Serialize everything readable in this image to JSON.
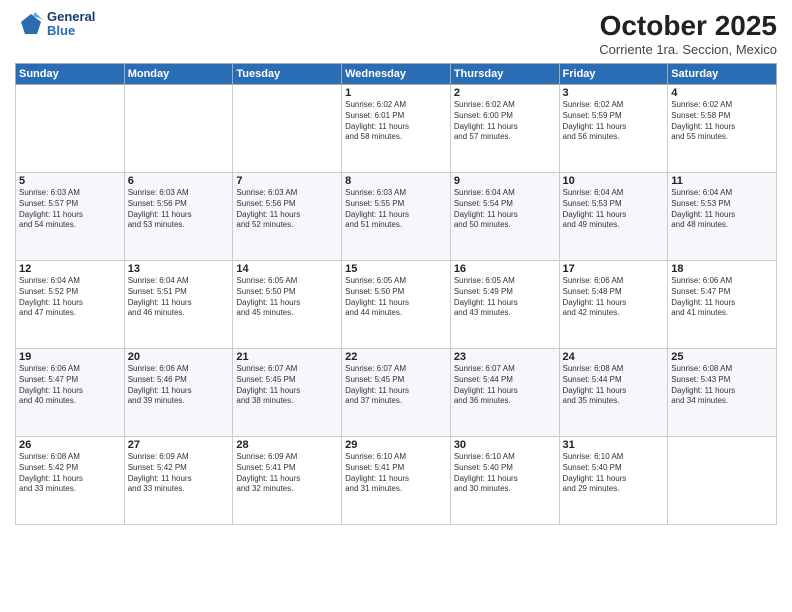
{
  "header": {
    "logo_line1": "General",
    "logo_line2": "Blue",
    "month_title": "October 2025",
    "subtitle": "Corriente 1ra. Seccion, Mexico"
  },
  "weekdays": [
    "Sunday",
    "Monday",
    "Tuesday",
    "Wednesday",
    "Thursday",
    "Friday",
    "Saturday"
  ],
  "weeks": [
    [
      {
        "day": "",
        "info": ""
      },
      {
        "day": "",
        "info": ""
      },
      {
        "day": "",
        "info": ""
      },
      {
        "day": "1",
        "info": "Sunrise: 6:02 AM\nSunset: 6:01 PM\nDaylight: 11 hours\nand 58 minutes."
      },
      {
        "day": "2",
        "info": "Sunrise: 6:02 AM\nSunset: 6:00 PM\nDaylight: 11 hours\nand 57 minutes."
      },
      {
        "day": "3",
        "info": "Sunrise: 6:02 AM\nSunset: 5:59 PM\nDaylight: 11 hours\nand 56 minutes."
      },
      {
        "day": "4",
        "info": "Sunrise: 6:02 AM\nSunset: 5:58 PM\nDaylight: 11 hours\nand 55 minutes."
      }
    ],
    [
      {
        "day": "5",
        "info": "Sunrise: 6:03 AM\nSunset: 5:57 PM\nDaylight: 11 hours\nand 54 minutes."
      },
      {
        "day": "6",
        "info": "Sunrise: 6:03 AM\nSunset: 5:56 PM\nDaylight: 11 hours\nand 53 minutes."
      },
      {
        "day": "7",
        "info": "Sunrise: 6:03 AM\nSunset: 5:56 PM\nDaylight: 11 hours\nand 52 minutes."
      },
      {
        "day": "8",
        "info": "Sunrise: 6:03 AM\nSunset: 5:55 PM\nDaylight: 11 hours\nand 51 minutes."
      },
      {
        "day": "9",
        "info": "Sunrise: 6:04 AM\nSunset: 5:54 PM\nDaylight: 11 hours\nand 50 minutes."
      },
      {
        "day": "10",
        "info": "Sunrise: 6:04 AM\nSunset: 5:53 PM\nDaylight: 11 hours\nand 49 minutes."
      },
      {
        "day": "11",
        "info": "Sunrise: 6:04 AM\nSunset: 5:53 PM\nDaylight: 11 hours\nand 48 minutes."
      }
    ],
    [
      {
        "day": "12",
        "info": "Sunrise: 6:04 AM\nSunset: 5:52 PM\nDaylight: 11 hours\nand 47 minutes."
      },
      {
        "day": "13",
        "info": "Sunrise: 6:04 AM\nSunset: 5:51 PM\nDaylight: 11 hours\nand 46 minutes."
      },
      {
        "day": "14",
        "info": "Sunrise: 6:05 AM\nSunset: 5:50 PM\nDaylight: 11 hours\nand 45 minutes."
      },
      {
        "day": "15",
        "info": "Sunrise: 6:05 AM\nSunset: 5:50 PM\nDaylight: 11 hours\nand 44 minutes."
      },
      {
        "day": "16",
        "info": "Sunrise: 6:05 AM\nSunset: 5:49 PM\nDaylight: 11 hours\nand 43 minutes."
      },
      {
        "day": "17",
        "info": "Sunrise: 6:06 AM\nSunset: 5:48 PM\nDaylight: 11 hours\nand 42 minutes."
      },
      {
        "day": "18",
        "info": "Sunrise: 6:06 AM\nSunset: 5:47 PM\nDaylight: 11 hours\nand 41 minutes."
      }
    ],
    [
      {
        "day": "19",
        "info": "Sunrise: 6:06 AM\nSunset: 5:47 PM\nDaylight: 11 hours\nand 40 minutes."
      },
      {
        "day": "20",
        "info": "Sunrise: 6:06 AM\nSunset: 5:46 PM\nDaylight: 11 hours\nand 39 minutes."
      },
      {
        "day": "21",
        "info": "Sunrise: 6:07 AM\nSunset: 5:45 PM\nDaylight: 11 hours\nand 38 minutes."
      },
      {
        "day": "22",
        "info": "Sunrise: 6:07 AM\nSunset: 5:45 PM\nDaylight: 11 hours\nand 37 minutes."
      },
      {
        "day": "23",
        "info": "Sunrise: 6:07 AM\nSunset: 5:44 PM\nDaylight: 11 hours\nand 36 minutes."
      },
      {
        "day": "24",
        "info": "Sunrise: 6:08 AM\nSunset: 5:44 PM\nDaylight: 11 hours\nand 35 minutes."
      },
      {
        "day": "25",
        "info": "Sunrise: 6:08 AM\nSunset: 5:43 PM\nDaylight: 11 hours\nand 34 minutes."
      }
    ],
    [
      {
        "day": "26",
        "info": "Sunrise: 6:08 AM\nSunset: 5:42 PM\nDaylight: 11 hours\nand 33 minutes."
      },
      {
        "day": "27",
        "info": "Sunrise: 6:09 AM\nSunset: 5:42 PM\nDaylight: 11 hours\nand 33 minutes."
      },
      {
        "day": "28",
        "info": "Sunrise: 6:09 AM\nSunset: 5:41 PM\nDaylight: 11 hours\nand 32 minutes."
      },
      {
        "day": "29",
        "info": "Sunrise: 6:10 AM\nSunset: 5:41 PM\nDaylight: 11 hours\nand 31 minutes."
      },
      {
        "day": "30",
        "info": "Sunrise: 6:10 AM\nSunset: 5:40 PM\nDaylight: 11 hours\nand 30 minutes."
      },
      {
        "day": "31",
        "info": "Sunrise: 6:10 AM\nSunset: 5:40 PM\nDaylight: 11 hours\nand 29 minutes."
      },
      {
        "day": "",
        "info": ""
      }
    ]
  ]
}
